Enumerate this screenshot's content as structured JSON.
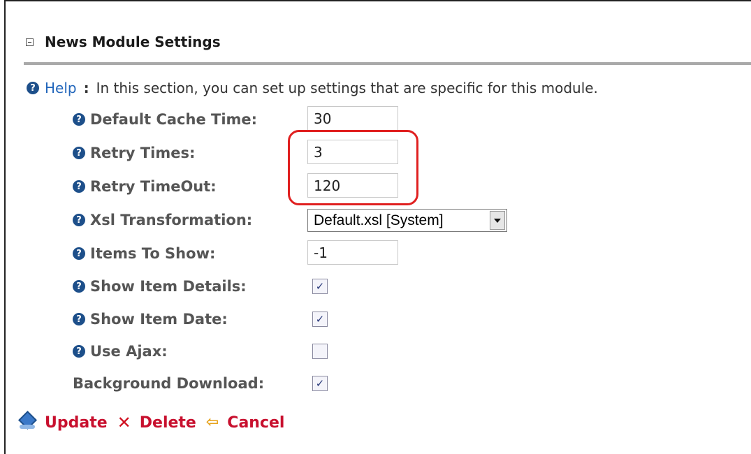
{
  "section": {
    "title": "News Module Settings",
    "collapse_icon": "collapse-box-icon"
  },
  "help": {
    "link_label": "Help",
    "colon": ":",
    "text": "In this section, you can set up settings that are specific for this module."
  },
  "settings": {
    "default_cache_time": {
      "label": "Default Cache Time:",
      "value": "30"
    },
    "retry_times": {
      "label": "Retry Times:",
      "value": "3"
    },
    "retry_timeout": {
      "label": "Retry TimeOut:",
      "value": "120"
    },
    "xsl_transformation": {
      "label": "Xsl Transformation:",
      "selected": "Default.xsl [System]"
    },
    "items_to_show": {
      "label": "Items To Show:",
      "value": "-1"
    },
    "show_item_details": {
      "label": "Show Item Details:",
      "checked": true
    },
    "show_item_date": {
      "label": "Show Item Date:",
      "checked": true
    },
    "use_ajax": {
      "label": "Use Ajax:",
      "checked": false
    },
    "background_download": {
      "label": "Background Download:",
      "checked": true
    }
  },
  "actions": {
    "update": "Update",
    "delete": "Delete",
    "cancel": "Cancel"
  },
  "colors": {
    "action_text": "#c8102e",
    "help_link": "#2266bb",
    "highlight_border": "#e02020",
    "help_icon": "#1d4f8a"
  }
}
